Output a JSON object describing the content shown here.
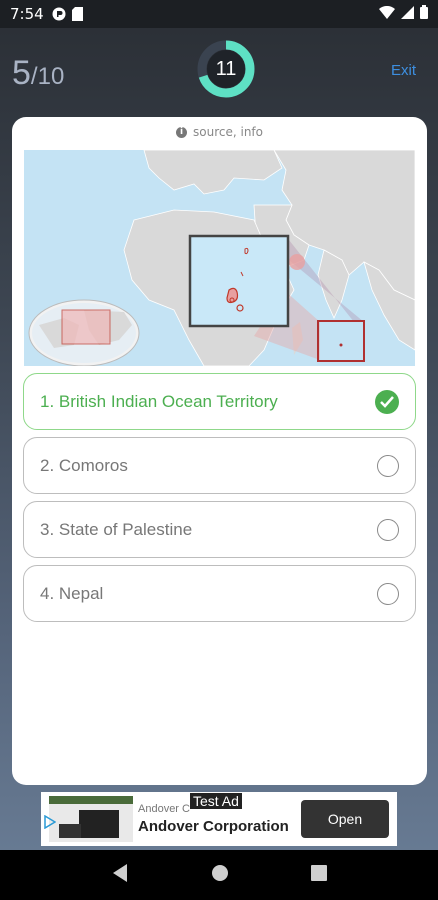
{
  "status": {
    "time": "7:54"
  },
  "header": {
    "score_current": "5",
    "score_total": "/10",
    "timer_value": "11",
    "timer_progress": 0.7,
    "exit_label": "Exit"
  },
  "question": {
    "source_label": "source, info"
  },
  "options": [
    {
      "label": "1. British Indian Ocean Territory",
      "state": "correct"
    },
    {
      "label": "2. Comoros",
      "state": "unselected"
    },
    {
      "label": "3. State of Palestine",
      "state": "unselected"
    },
    {
      "label": "4. Nepal",
      "state": "unselected"
    }
  ],
  "ad": {
    "tag": "Test Ad",
    "advertiser_small": "Andover C",
    "title": "Andover Corporation",
    "button": "Open"
  },
  "colors": {
    "accent": "#3d8fe0",
    "correct": "#4caf50",
    "timer_ring": "#5ee0c4"
  },
  "icons": {
    "status": [
      "notification-icon",
      "sd-card-icon",
      "wifi-icon",
      "signal-icon",
      "battery-icon"
    ],
    "nav": [
      "back-icon",
      "home-icon",
      "recents-icon"
    ]
  }
}
